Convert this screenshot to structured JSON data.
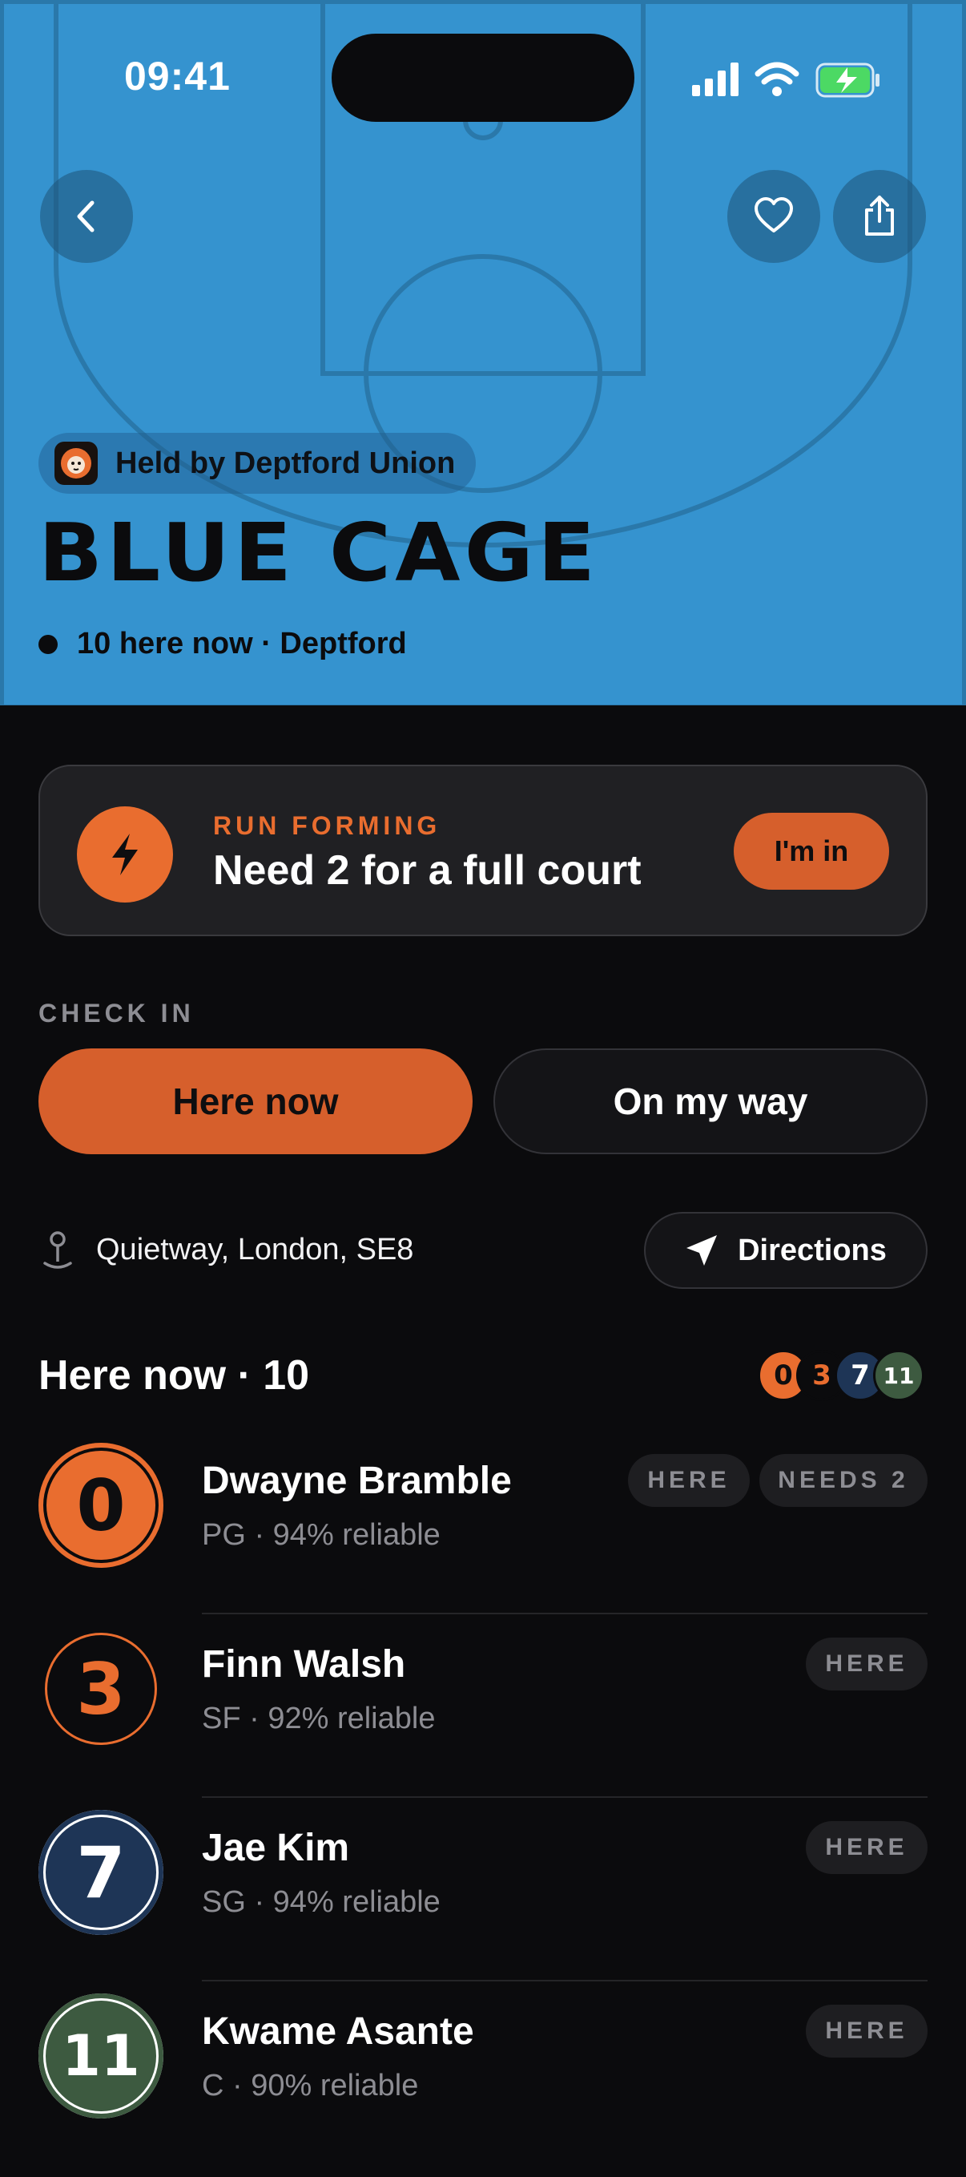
{
  "status_bar": {
    "time": "09:41"
  },
  "hero": {
    "held_by": "Held by Deptford Union",
    "title": "BLUE CAGE",
    "subtitle": "10 here now · Deptford",
    "bg_color": "#3593cf"
  },
  "run_card": {
    "eyebrow": "RUN FORMING",
    "title": "Need 2 for a full court",
    "cta": "I'm in",
    "accent": "#e96d2f"
  },
  "check_in": {
    "label": "CHECK IN",
    "primary": "Here now",
    "secondary": "On my way"
  },
  "location": {
    "address": "Quietway, London, SE8",
    "directions": "Directions"
  },
  "here_now": {
    "title": "Here now · 10",
    "stack": [
      "0",
      "3",
      "7",
      "11"
    ],
    "players": [
      {
        "number": "0",
        "name": "Dwayne Bramble",
        "meta": "PG · 94% reliable",
        "chips": [
          "HERE",
          "NEEDS 2"
        ]
      },
      {
        "number": "3",
        "name": "Finn Walsh",
        "meta": "SF · 92% reliable",
        "chips": [
          "HERE"
        ]
      },
      {
        "number": "7",
        "name": "Jae Kim",
        "meta": "SG · 94% reliable",
        "chips": [
          "HERE"
        ]
      },
      {
        "number": "11",
        "name": "Kwame Asante",
        "meta": "C · 90% reliable",
        "chips": [
          "HERE"
        ]
      }
    ]
  }
}
